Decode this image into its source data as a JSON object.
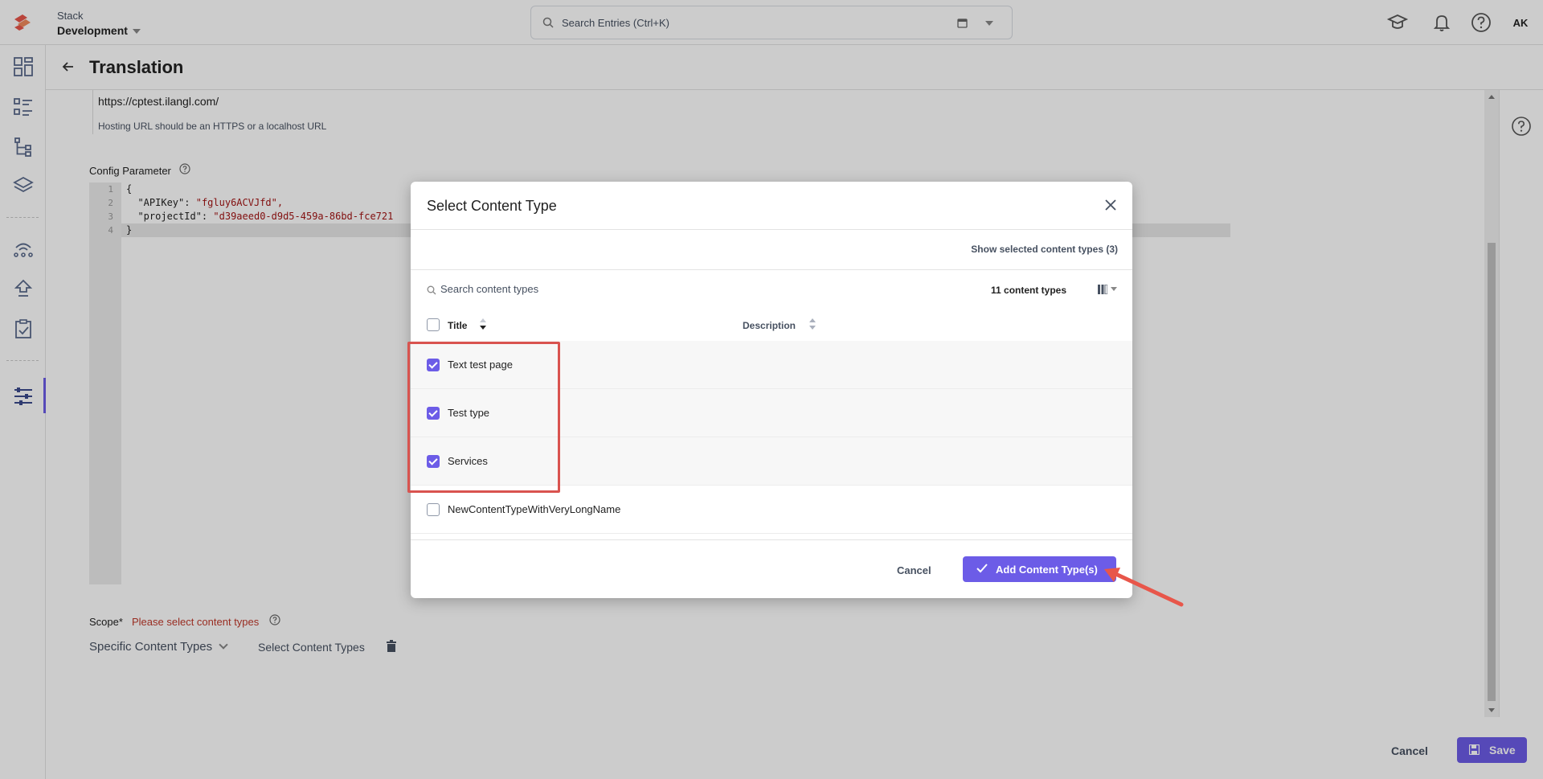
{
  "header": {
    "stack_label": "Stack",
    "stack_env": "Development",
    "search_placeholder": "Search Entries (Ctrl+K)",
    "avatar_initials": "AK"
  },
  "page": {
    "title": "Translation",
    "hosting_url": "https://cptest.ilangl.com/",
    "hosting_url_help": "Hosting URL should be an HTTPS or a localhost URL",
    "config_label": "Config Parameter",
    "code_lines": [
      "1",
      "2",
      "3",
      "4"
    ],
    "code": {
      "open_brace": "{",
      "k1": "\"APIKey\":",
      "v1": "\"fgluy6ACVJfd\",",
      "k2": "\"projectId\":",
      "v2": "\"d39aeed0-d9d5-459a-86bd-fce721",
      "close_brace": "}"
    },
    "scope_label": "Scope*",
    "scope_error": "Please select content types",
    "scope_type": "Specific Content Types",
    "scope_select": "Select Content Types",
    "footer_cancel": "Cancel",
    "footer_save": "Save"
  },
  "modal": {
    "title": "Select Content Type",
    "show_selected": "Show selected content types (3)",
    "search_placeholder": "Search content types",
    "count": "11 content types",
    "col_title": "Title",
    "col_description": "Description",
    "rows": [
      {
        "label": "Text test page",
        "checked": true
      },
      {
        "label": "Test type",
        "checked": true
      },
      {
        "label": "Services",
        "checked": true
      },
      {
        "label": "NewContentTypeWithVeryLongName",
        "checked": false
      }
    ],
    "cancel": "Cancel",
    "add": "Add Content Type(s)"
  },
  "colors": {
    "accent": "#6c5ce7",
    "error": "#c0392b",
    "annotation": "#d9534f"
  }
}
